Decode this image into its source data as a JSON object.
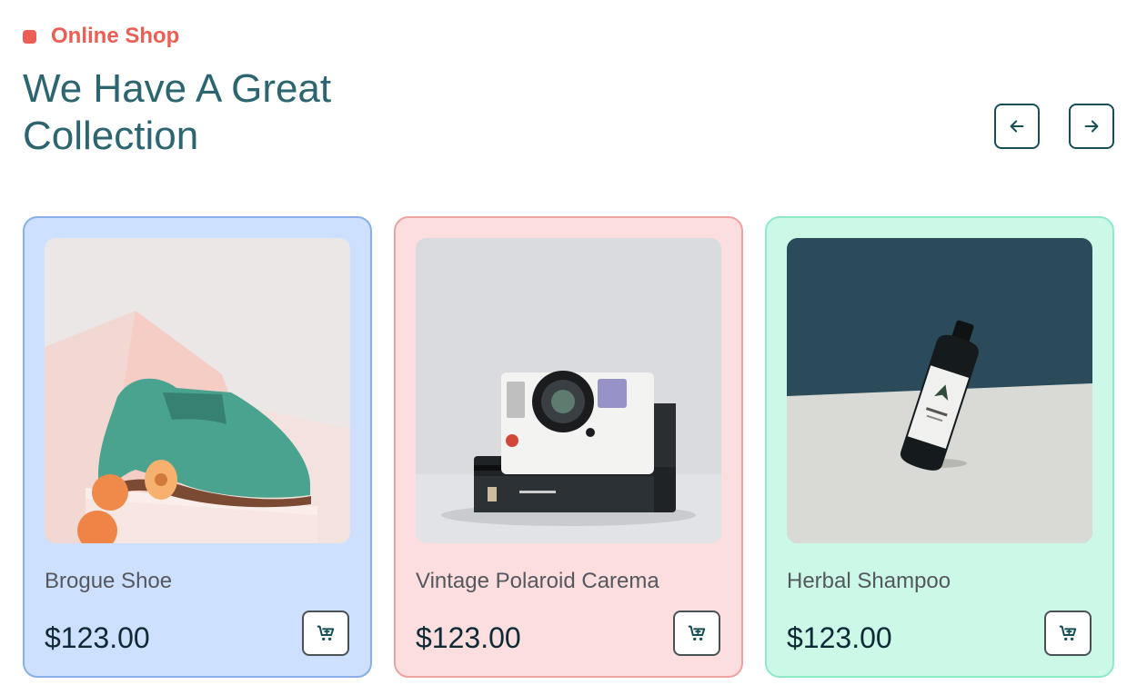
{
  "section": {
    "eyebrow": "Online Shop",
    "heading": "We Have A Great Collection"
  },
  "carousel": {
    "prev_icon": "arrow-left-icon",
    "next_icon": "arrow-right-icon"
  },
  "products": [
    {
      "name": "Brogue Shoe",
      "price": "$123.00",
      "image": "green suede brogue shoe with peaches on pink blocks",
      "card_color": "#cee0ff"
    },
    {
      "name": "Vintage Polaroid Carema",
      "price": "$123.00",
      "image": "white and black instant camera on grey background",
      "card_color": "#fbdedd"
    },
    {
      "name": "Herbal Shampoo",
      "price": "$123.00",
      "image": "dark shampoo bottle on grey surface with navy wall",
      "card_color": "#cbf8e7"
    }
  ],
  "colors": {
    "accent": "#eb5e55",
    "heading": "#2c6570",
    "dark": "#174f58"
  }
}
